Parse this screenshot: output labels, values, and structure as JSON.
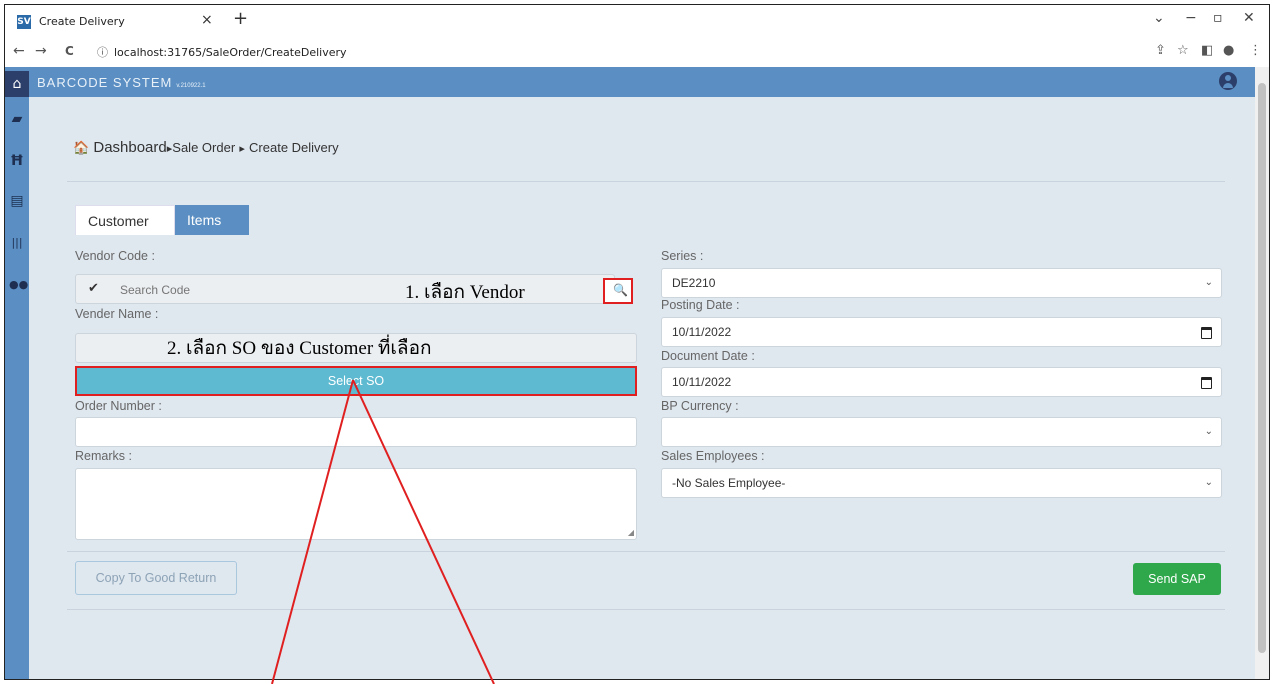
{
  "browser": {
    "tab_title": "Create Delivery",
    "favicon_text": "SV",
    "tab_close": "×",
    "new_tab": "+",
    "url": "localhost:31765/SaleOrder/CreateDelivery",
    "back": "←",
    "forward": "→",
    "reload": "C",
    "info": "ⓘ",
    "share_icon": "⇪",
    "star_icon": "☆",
    "sidepanel_icon": "◧",
    "profile_icon": "●",
    "menu_icon": "⋮",
    "win_dropdown": "⌄",
    "win_min": "−",
    "win_max": "▫",
    "win_close": "✕"
  },
  "app": {
    "brand": "BARCODE SYSTEM",
    "version": "v.210922.1",
    "accent": "#5b8fc3"
  },
  "sidebar": {
    "icons": [
      "home-icon",
      "truck-icon",
      "cart-icon",
      "warehouse-icon",
      "barcode-icon",
      "users-icon"
    ]
  },
  "breadcrumb": {
    "home_icon": "🏠",
    "dashboard": "Dashboard",
    "sep": "▸",
    "sale_order": "Sale Order",
    "create_delivery": "Create Delivery"
  },
  "tabs": {
    "customer": "Customer",
    "items": "Items"
  },
  "form": {
    "vendor_code_label": "Vendor Code :",
    "search_placeholder": "Search Code",
    "check_icon": "✔",
    "search_icon": "🔍",
    "vender_name_label": "Vender Name :",
    "select_so": "Select SO",
    "order_number_label": "Order Number :",
    "remarks_label": "Remarks :",
    "series_label": "Series :",
    "series_value": "DE2210",
    "posting_date_label": "Posting Date :",
    "posting_date_value": "10/11/2022",
    "document_date_label": "Document Date :",
    "document_date_value": "10/11/2022",
    "bp_currency_label": "BP Currency :",
    "sales_employees_label": "Sales Employees :",
    "sales_employees_value": "-No Sales Employee-",
    "chevron": "⌄"
  },
  "buttons": {
    "copy_to_good_return": "Copy To Good Return",
    "send_sap": "Send SAP",
    "send_color": "#2ea84a"
  },
  "annotations": {
    "step1": "1. เลือก Vendor",
    "step2": "2. เลือก SO ของ Customer ที่เลือก",
    "highlight_color": "#e02020"
  }
}
